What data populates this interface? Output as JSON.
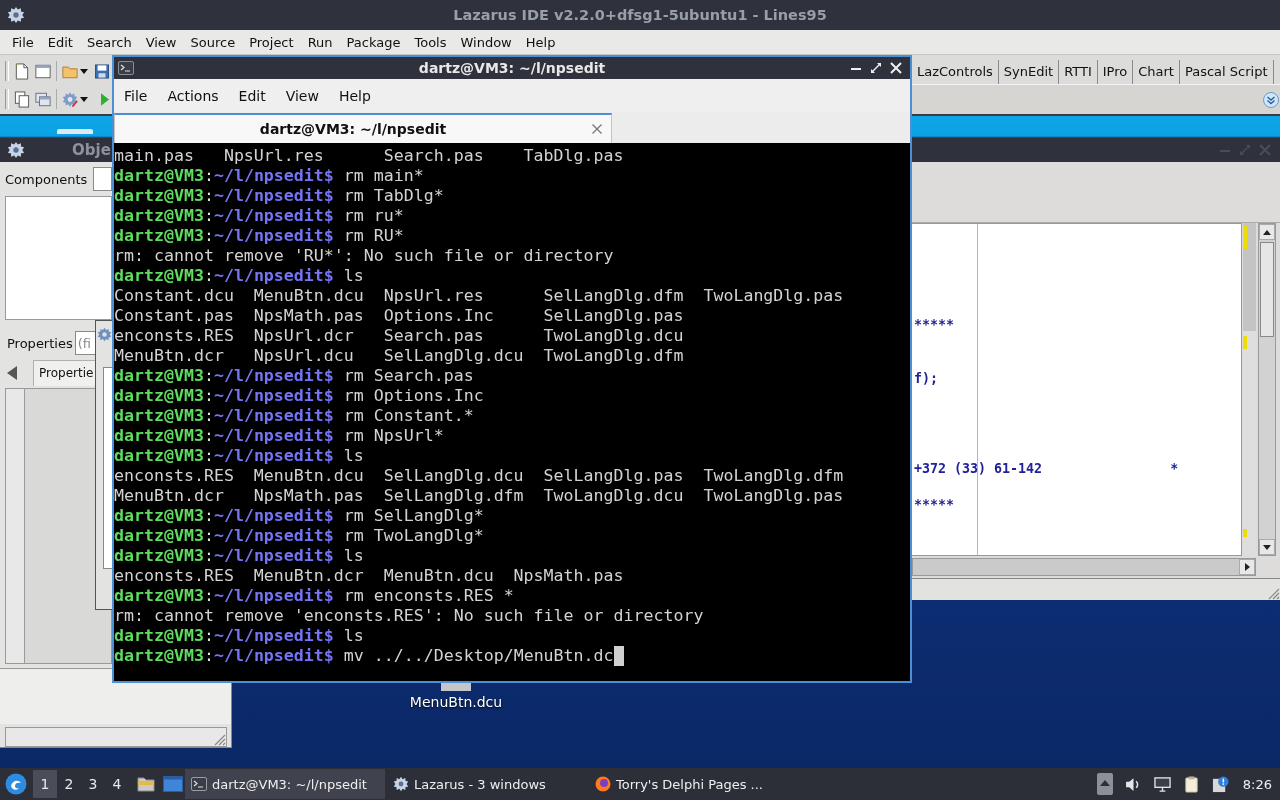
{
  "lazarus": {
    "title": "Lazarus IDE v2.2.0+dfsg1-5ubuntu1 - Lines95",
    "menu": [
      "File",
      "Edit",
      "Search",
      "View",
      "Source",
      "Project",
      "Run",
      "Package",
      "Tools",
      "Window",
      "Help"
    ],
    "palette_tabs": [
      {
        "label": "LazControls",
        "selected": false
      },
      {
        "label": "SynEdit",
        "selected": false
      },
      {
        "label": "RTTI",
        "selected": false
      },
      {
        "label": "IPro",
        "selected": false
      },
      {
        "label": "Chart",
        "selected": false
      },
      {
        "label": "Pascal Script",
        "selected": false
      }
    ]
  },
  "object_inspector": {
    "title": "Obje",
    "components_label": "Components",
    "properties_label": "Properties",
    "filter": {
      "placeholder": "(fi"
    },
    "tabs": [
      {
        "label": "Propertie",
        "selected": true
      }
    ]
  },
  "source_editor": {
    "lines": [
      "*****",
      "f);",
      "+372 (33) 61-142                *",
      "*****"
    ]
  },
  "terminal": {
    "title": "dartz@VM3: ~/l/npsedit",
    "menu": [
      "File",
      "Actions",
      "Edit",
      "View",
      "Help"
    ],
    "tabs": [
      {
        "label": "dartz@VM3: ~/l/npsedit",
        "selected": true
      }
    ],
    "cursor_visible": true,
    "lines": [
      {
        "kind": "output",
        "text": "main.pas   NpsUrl.res      Search.pas    TabDlg.pas"
      },
      {
        "kind": "prompt",
        "user": "dartz@VM3",
        "separator": ":",
        "path": "~/l/npsedit",
        "symbol": "$",
        "command": "rm main*"
      },
      {
        "kind": "prompt",
        "user": "dartz@VM3",
        "separator": ":",
        "path": "~/l/npsedit",
        "symbol": "$",
        "command": "rm TabDlg*"
      },
      {
        "kind": "prompt",
        "user": "dartz@VM3",
        "separator": ":",
        "path": "~/l/npsedit",
        "symbol": "$",
        "command": "rm ru*"
      },
      {
        "kind": "prompt",
        "user": "dartz@VM3",
        "separator": ":",
        "path": "~/l/npsedit",
        "symbol": "$",
        "command": "rm RU*"
      },
      {
        "kind": "output",
        "text": "rm: cannot remove 'RU*': No such file or directory"
      },
      {
        "kind": "prompt",
        "user": "dartz@VM3",
        "separator": ":",
        "path": "~/l/npsedit",
        "symbol": "$",
        "command": "ls"
      },
      {
        "kind": "output",
        "text": "Constant.dcu  MenuBtn.dcu  NpsUrl.res      SelLangDlg.dfm  TwoLangDlg.pas"
      },
      {
        "kind": "output",
        "text": "Constant.pas  NpsMath.pas  Options.Inc     SelLangDlg.pas"
      },
      {
        "kind": "output",
        "text": "enconsts.RES  NpsUrl.dcr   Search.pas      TwoLangDlg.dcu"
      },
      {
        "kind": "output",
        "text": "MenuBtn.dcr   NpsUrl.dcu   SelLangDlg.dcu  TwoLangDlg.dfm"
      },
      {
        "kind": "prompt",
        "user": "dartz@VM3",
        "separator": ":",
        "path": "~/l/npsedit",
        "symbol": "$",
        "command": "rm Search.pas"
      },
      {
        "kind": "prompt",
        "user": "dartz@VM3",
        "separator": ":",
        "path": "~/l/npsedit",
        "symbol": "$",
        "command": "rm Options.Inc"
      },
      {
        "kind": "prompt",
        "user": "dartz@VM3",
        "separator": ":",
        "path": "~/l/npsedit",
        "symbol": "$",
        "command": "rm Constant.*"
      },
      {
        "kind": "prompt",
        "user": "dartz@VM3",
        "separator": ":",
        "path": "~/l/npsedit",
        "symbol": "$",
        "command": "rm NpsUrl*"
      },
      {
        "kind": "prompt",
        "user": "dartz@VM3",
        "separator": ":",
        "path": "~/l/npsedit",
        "symbol": "$",
        "command": "ls"
      },
      {
        "kind": "output",
        "text": "enconsts.RES  MenuBtn.dcu  SelLangDlg.dcu  SelLangDlg.pas  TwoLangDlg.dfm"
      },
      {
        "kind": "output",
        "text": "MenuBtn.dcr   NpsMath.pas  SelLangDlg.dfm  TwoLangDlg.dcu  TwoLangDlg.pas"
      },
      {
        "kind": "prompt",
        "user": "dartz@VM3",
        "separator": ":",
        "path": "~/l/npsedit",
        "symbol": "$",
        "command": "rm SelLangDlg*"
      },
      {
        "kind": "prompt",
        "user": "dartz@VM3",
        "separator": ":",
        "path": "~/l/npsedit",
        "symbol": "$",
        "command": "rm TwoLangDlg*"
      },
      {
        "kind": "prompt",
        "user": "dartz@VM3",
        "separator": ":",
        "path": "~/l/npsedit",
        "symbol": "$",
        "command": "ls"
      },
      {
        "kind": "output",
        "text": "enconsts.RES  MenuBtn.dcr  MenuBtn.dcu  NpsMath.pas"
      },
      {
        "kind": "prompt",
        "user": "dartz@VM3",
        "separator": ":",
        "path": "~/l/npsedit",
        "symbol": "$",
        "command": "rm enconsts.RES *"
      },
      {
        "kind": "output",
        "text": "rm: cannot remove 'enconsts.RES': No such file or directory"
      },
      {
        "kind": "prompt",
        "user": "dartz@VM3",
        "separator": ":",
        "path": "~/l/npsedit",
        "symbol": "$",
        "command": "ls"
      },
      {
        "kind": "prompt",
        "user": "dartz@VM3",
        "separator": ":",
        "path": "~/l/npsedit",
        "symbol": "$",
        "command": "mv ../../Desktop/MenuBtn.dc"
      }
    ]
  },
  "desktop_icons": [
    {
      "label": "MenuBtn.dcu"
    }
  ],
  "taskbar": {
    "workspaces": [
      {
        "label": "1",
        "selected": true
      },
      {
        "label": "2",
        "selected": false
      },
      {
        "label": "3",
        "selected": false
      },
      {
        "label": "4",
        "selected": false
      }
    ],
    "tasks": [
      {
        "kind": "terminal",
        "label": "dartz@VM3: ~/l/npsedit",
        "selected": true
      },
      {
        "kind": "ide",
        "label": "Lazarus - 3 windows",
        "selected": false
      },
      {
        "kind": "browser",
        "label": "Torry's Delphi Pages ...",
        "selected": false
      }
    ],
    "clock": "8:26"
  }
}
